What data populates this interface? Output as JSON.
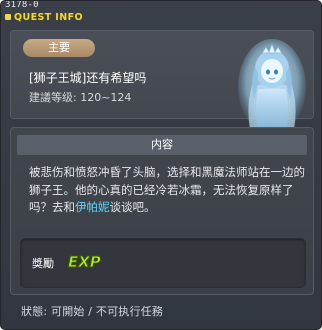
{
  "window": {
    "quest_id": "3178-0",
    "title": "QUEST INFO"
  },
  "quest": {
    "category": "主要",
    "name": "[狮子王城]还有希望吗",
    "level": "建議等级: 120~124"
  },
  "content": {
    "header": "内容",
    "description_before": "被悲伤和愤怒冲昏了头脑，选择和黑魔法师站在一边的狮子王。他的心真的已经冷若冰霜，无法恢复原样了吗？去和",
    "npc_name": "伊帕妮",
    "description_after": "谈谈吧。"
  },
  "reward": {
    "label": "獎勵",
    "exp_text": "EXP"
  },
  "status": {
    "text": "狀態: 可開始 / 不可执行任務"
  },
  "colors": {
    "title_yellow": "#f4d437",
    "npc_link": "#5ed6ff",
    "badge": "#b89a74",
    "exp_green": "#b4ec26"
  },
  "icons": {
    "npc_portrait": "ghost-queen-portrait",
    "exp": "exp-icon"
  }
}
